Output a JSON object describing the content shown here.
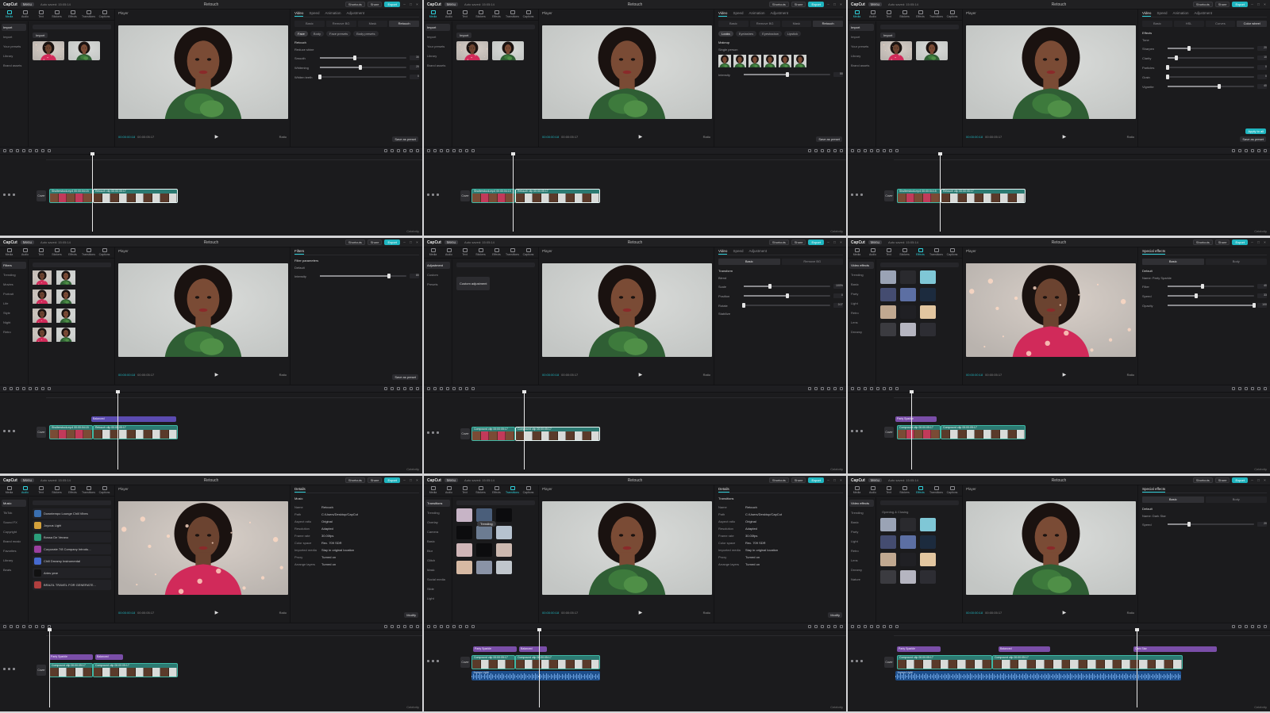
{
  "colors": {
    "accent": "#1fb5bf",
    "clip": "#2c7a72",
    "effect": "#7a4ea8",
    "audio": "#1e4f8c",
    "background": "#1b1b1d"
  },
  "common": {
    "app_name": "CapCut",
    "menu_label": "Menu",
    "autosave": "Auto saved: 15:05:14",
    "project_title": "Retouch",
    "shortcuts_label": "Shortcuts",
    "share_label": "Share",
    "export_label": "Export",
    "player_label": "Player",
    "cover_label": "Cover",
    "timecode": "00:00:00:18",
    "duration": "00:00:05:17",
    "ratio": "Ratio",
    "tools": [
      "Media",
      "Audio",
      "Text",
      "Stickers",
      "Effects",
      "Transitions",
      "Captions",
      "Filters",
      "Adjustment"
    ],
    "save_preset": "Save as preset",
    "corner_label": "Celebrity"
  },
  "panels": [
    {
      "id": "p1",
      "nav": [
        "Import",
        "Import",
        "Your presets",
        "Library",
        "Brand assets"
      ],
      "tab": [
        "Video",
        "Speed",
        "Animation",
        "Adjustment"
      ],
      "subtabs": [
        "Basic",
        "Remove BG",
        "Mask",
        "Retouch"
      ],
      "chips": [
        "Face",
        "Body",
        "Face presets",
        "Body presets"
      ],
      "section": "Retouch",
      "rows": [
        {
          "label": "Smooth",
          "value": "30",
          "level": 0.4
        },
        {
          "label": "Whitening",
          "value": "20",
          "level": 0.47
        },
        {
          "label": "Whiten teeth",
          "value": "0",
          "level": 0.0
        }
      ],
      "extra": "Reduce shine",
      "clips": [
        "Shutterstock.mp4  00:00:04:15",
        "Retouch clip  00:00:05:17"
      ],
      "tool_on": 0
    },
    {
      "id": "p2",
      "nav": [
        "Import",
        "Import",
        "Your presets",
        "Library",
        "Brand assets"
      ],
      "tab": [
        "Video",
        "Speed",
        "Animation",
        "Adjustment"
      ],
      "subtabs": [
        "Basic",
        "Remove BG",
        "Mask",
        "Retouch"
      ],
      "chips": [
        "Looks",
        "Eyelashes",
        "Eyeshadow",
        "Lipstick"
      ],
      "section": "Makeup",
      "rows": [
        {
          "label": "Intensity",
          "value": "50",
          "level": 0.5
        }
      ],
      "extra": "Single person",
      "clips": [
        "Shutterstock.mp4  00:00:04:15",
        "Retouch clip  00:00:05:17"
      ],
      "tool_on": 0
    },
    {
      "id": "p3",
      "nav": [
        "Import",
        "Import",
        "Your presets",
        "Library",
        "Brand assets"
      ],
      "tab": [
        "Video",
        "Speed",
        "Animation",
        "Adjustment"
      ],
      "subtabs": [
        "Basic",
        "HSL",
        "Curves",
        "Color wheel"
      ],
      "section": "Effects",
      "rows": [
        {
          "label": "Sharpen",
          "value": "20",
          "level": 0.25
        },
        {
          "label": "Clarity",
          "value": "10",
          "level": 0.1
        },
        {
          "label": "Particles",
          "value": "0",
          "level": 0.0
        },
        {
          "label": "Grain",
          "value": "0",
          "level": 0.0
        },
        {
          "label": "Vignette",
          "value": "40",
          "level": 0.6
        }
      ],
      "extra": "Tone",
      "clips": [
        "Shutterstock.mp4  00:00:04:15",
        "Retouch clip  00:00:05:17"
      ],
      "tool_on": 0,
      "save2": "Apply to all"
    },
    {
      "id": "p4",
      "nav": [
        "Filters",
        "Trending",
        "Movies",
        "Portrait",
        "Life",
        "Style",
        "Night",
        "Retro"
      ],
      "tab": [
        "Filters"
      ],
      "section": "Filter parameters",
      "rows": [
        {
          "label": "Intensity",
          "value": "80",
          "level": 0.8
        }
      ],
      "extra": "Default",
      "clips": [
        "Shutterstock.mp4  00:00:04:15",
        "Retouch clip  00:00:05:17"
      ],
      "fx": "Balanced",
      "tool_on": 7
    },
    {
      "id": "p5",
      "nav": [
        "Adjustment",
        "Custom",
        "Presets"
      ],
      "tab": [
        "Video",
        "Speed",
        "Adjustment"
      ],
      "subtabs": [
        "Basic",
        "Remove BG"
      ],
      "section": "Transform",
      "rows": [
        {
          "label": "Scale",
          "value": "100%",
          "level": 0.3
        },
        {
          "label": "Position",
          "value": "0",
          "level": 0.5
        },
        {
          "label": "Rotate",
          "value": "0.0°",
          "level": 0.0
        }
      ],
      "extra": "Blend",
      "extra2": "Stabilize",
      "custom_label": "Custom adjustment",
      "clips": [
        "Compound clip  00:00:05:17",
        "Compound clip  00:00:05:17"
      ],
      "tool_on": 8
    },
    {
      "id": "p6",
      "nav": [
        "Video effects",
        "Trending",
        "Basic",
        "Party",
        "Light",
        "Retro",
        "Lens",
        "Dreamy"
      ],
      "tab": [
        "Special effects"
      ],
      "subtabs": [
        "Basic",
        "Body"
      ],
      "section": "Default",
      "rows": [
        {
          "label": "Filter",
          "value": "40",
          "level": 0.4
        },
        {
          "label": "Speed",
          "value": "33",
          "level": 0.33
        },
        {
          "label": "Opacity",
          "value": "100",
          "level": 1.0
        }
      ],
      "extra": "Name: Party Sparkle",
      "clips": [
        "Compound clip  00:00:05:17",
        "Compound clip  00:00:05:17"
      ],
      "fx": "Party Sparkle",
      "tool_on": 4
    },
    {
      "id": "p7",
      "nav": [
        "Music",
        "TikTok",
        "Sound FX",
        "Copyright",
        "Brand music",
        "Favorites",
        "Library",
        "Beats"
      ],
      "tab": [
        "Details"
      ],
      "section": "Music",
      "songs": [
        "Downtempo Lounge Chill Vibes",
        "Joyous Light",
        "Bossa De Verano",
        "Corporate 7/8 Company Introdu...",
        "Chill Dreamy Instrumental",
        "Aries year",
        "BRAZIL TRAVEL FOR GENERATE..."
      ],
      "info": [
        [
          "Name",
          "Retouch"
        ],
        [
          "Path",
          "C:/Users/Desktop/CapCut"
        ],
        [
          "Aspect ratio",
          "Original"
        ],
        [
          "Resolution",
          "Adapted"
        ],
        [
          "Frame rate",
          "30.00fps"
        ],
        [
          "Color space",
          "Rec. 709 SDR"
        ],
        [
          "Imported media",
          "Stay in original location"
        ],
        [
          "Proxy",
          "Turned on"
        ],
        [
          "Arrange layers",
          "Turned on"
        ]
      ],
      "modify": "Modify",
      "clips": [
        "Compound clip  00:00:05:17",
        "Compound clip  00:00:05:17"
      ],
      "fx": "Party Sparkle",
      "fx2": "Balanced",
      "tool_on": 1
    },
    {
      "id": "p8",
      "nav": [
        "Transitions",
        "Trending",
        "Overlay",
        "Camera",
        "Basic",
        "Blur",
        "Glitch",
        "Mask",
        "Social media",
        "Slide",
        "Light"
      ],
      "tab": [
        "Details"
      ],
      "section": "Transitions",
      "tooltip": "Trending",
      "info": [
        [
          "Name",
          "Retouch"
        ],
        [
          "Path",
          "C:/Users/Desktop/CapCut"
        ],
        [
          "Aspect ratio",
          "Original"
        ],
        [
          "Resolution",
          "Adapted"
        ],
        [
          "Frame rate",
          "30.00fps"
        ],
        [
          "Color space",
          "Rec. 709 SDR"
        ],
        [
          "Imported media",
          "Stay in original location"
        ],
        [
          "Proxy",
          "Turned on"
        ],
        [
          "Arrange layers",
          "Turned on"
        ]
      ],
      "modify": "Modify",
      "clips": [
        "Compound clip  00:00:05:17",
        "Compound clip  00:00:05:17"
      ],
      "fx": "Party Sparkle",
      "fx2": "Balanced",
      "audio": "Joyous Light",
      "tool_on": 5
    },
    {
      "id": "p9",
      "nav": [
        "Video effects",
        "Trending",
        "Basic",
        "Party",
        "Light",
        "Retro",
        "Lens",
        "Dreamy",
        "Nature"
      ],
      "tab": [
        "Special effects"
      ],
      "subtabs": [
        "Basic",
        "Body"
      ],
      "section": "Default",
      "rows": [
        {
          "label": "Speed",
          "value": "20",
          "level": 0.25
        }
      ],
      "extra": "Name: Dark Star",
      "grid_label": "Opening & Closing",
      "clips": [
        "Compound clip  00:00:05:17",
        "Compound clip  00:00:05:17"
      ],
      "fx": "Party Sparkle",
      "fx2": "Balanced",
      "fx3": "Dark Star",
      "audio": "Joyous Light",
      "tool_on": 4
    }
  ]
}
